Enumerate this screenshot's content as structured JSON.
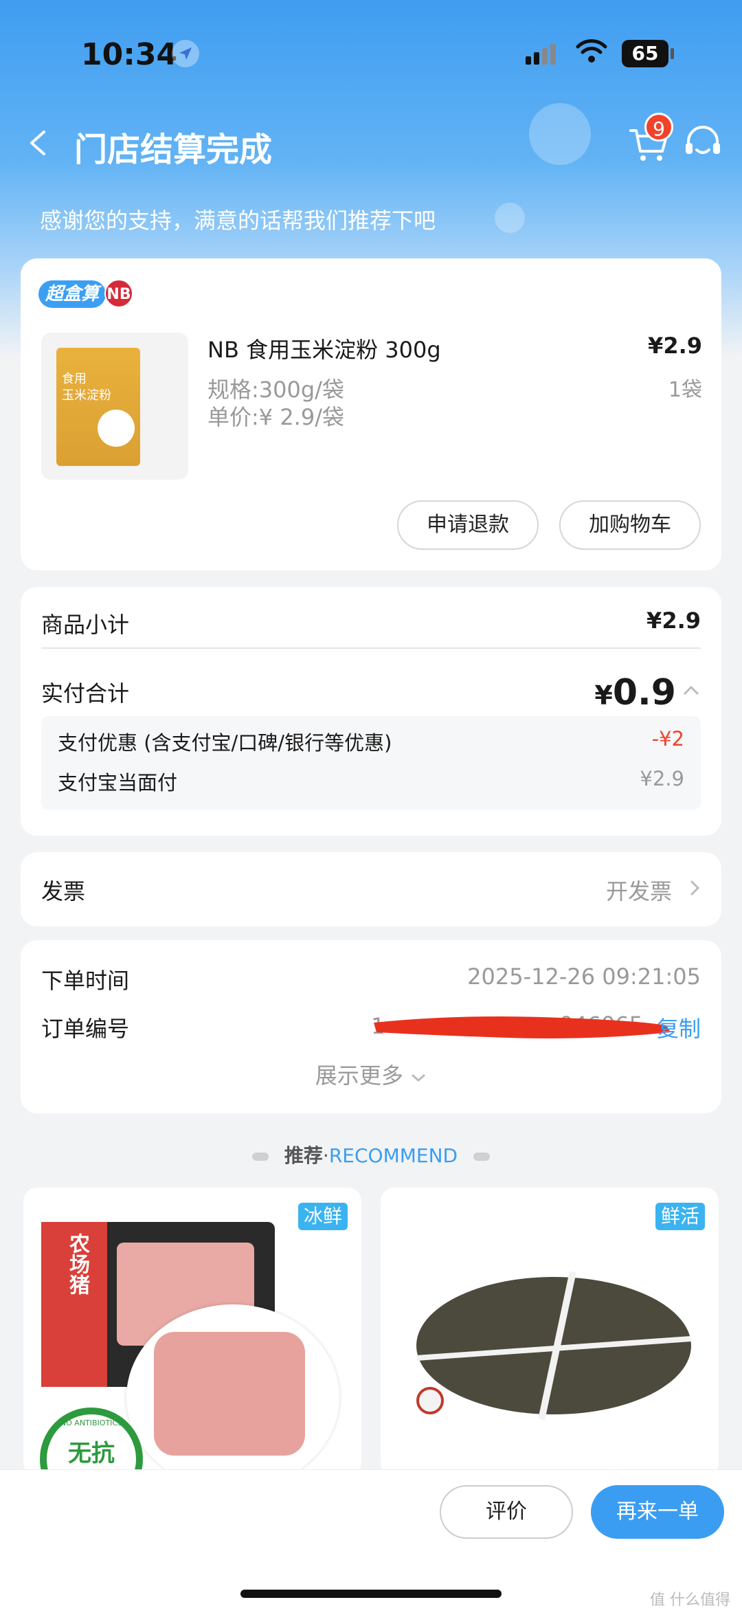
{
  "status": {
    "time": "10:34",
    "battery": "65"
  },
  "nav": {
    "title": "门店结算完成",
    "cart_count": "9"
  },
  "subtitle": "感谢您的支持，满意的话帮我们推荐下吧",
  "product": {
    "tag_chao": "超盒算",
    "tag_nb": "NB",
    "name": "NB 食用玉米淀粉 300g",
    "spec": "规格:300g/袋",
    "unit_price": "单价:¥ 2.9/袋",
    "price": "¥2.9",
    "qty": "1袋",
    "package_text": "食用\n玉米淀粉",
    "btn_refund": "申请退款",
    "btn_add_cart": "加购物车"
  },
  "summary": {
    "subtotal_label": "商品小计",
    "subtotal_value": "¥2.9",
    "total_label": "实付合计",
    "total_currency": "¥",
    "total_value": "0.9",
    "discount_label": "支付优惠 (含支付宝/口碑/银行等优惠)",
    "discount_value": "-¥2",
    "alipay_label": "支付宝当面付",
    "alipay_value": "¥2.9"
  },
  "invoice": {
    "label": "发票",
    "action": "开发票"
  },
  "order": {
    "time_label": "下单时间",
    "time_value": "2025-12-26 09:21:05",
    "no_label": "订单编号",
    "no_value": "1",
    "no_visible_tail": "046065",
    "copy": "复制",
    "more": "展示更多"
  },
  "recommend": {
    "title_cn": "推荐",
    "dot": "·",
    "title_en": "RECOMMEND",
    "items": [
      {
        "tag": "冰鲜",
        "badge_cn": "无抗",
        "badge_en": "NO ANTIBIOTICS",
        "label": "农场猪"
      },
      {
        "tag": "鲜活"
      }
    ]
  },
  "bottom": {
    "review": "评价",
    "reorder": "再来一单"
  },
  "watermark": "值 什么值得买",
  "colors": {
    "accent": "#3a9df2",
    "red": "#f0432b"
  }
}
